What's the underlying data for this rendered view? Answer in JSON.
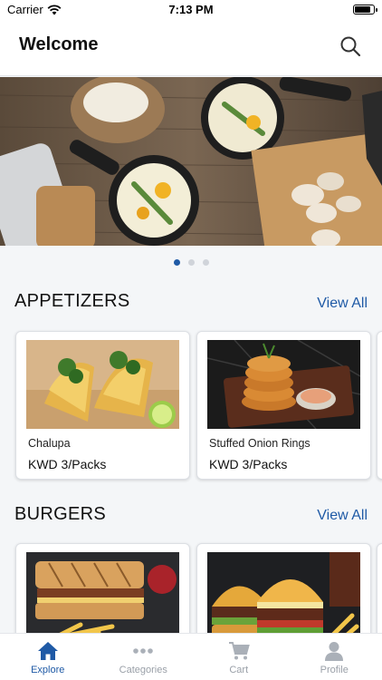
{
  "status_bar": {
    "carrier": "Carrier",
    "time": "7:13 PM",
    "battery_level": 0.9
  },
  "header": {
    "title": "Welcome",
    "search_icon": "search-icon"
  },
  "hero": {
    "slides": 3,
    "active_slide": 1
  },
  "sections": [
    {
      "title": "APPETIZERS",
      "view_all": "View All",
      "items": [
        {
          "name": "Chalupa",
          "price": "KWD 3/Packs"
        },
        {
          "name": "Stuffed Onion Rings",
          "price": "KWD 3/Packs"
        }
      ]
    },
    {
      "title": "BURGERS",
      "view_all": "View All",
      "items": [
        {
          "name": "",
          "price": ""
        },
        {
          "name": "",
          "price": ""
        }
      ]
    }
  ],
  "tab_bar": [
    {
      "label": "Explore",
      "icon": "home-icon",
      "active": true
    },
    {
      "label": "Categories",
      "icon": "more-dots-icon",
      "active": false
    },
    {
      "label": "Cart",
      "icon": "cart-icon",
      "active": false
    },
    {
      "label": "Profile",
      "icon": "profile-icon",
      "active": false
    }
  ],
  "colors": {
    "accent": "#1f5aa6",
    "inactive": "#9aa0a8",
    "background": "#f4f6f8"
  }
}
